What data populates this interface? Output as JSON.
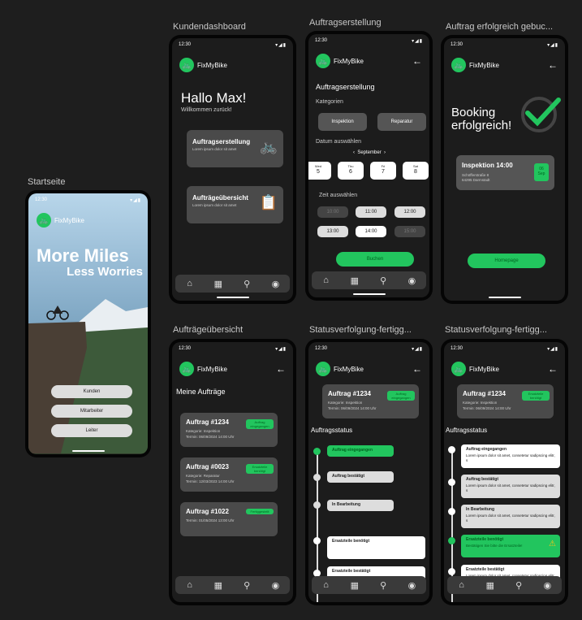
{
  "frames": {
    "startseite": "Startseite",
    "kundendashboard": "Kundendashboard",
    "auftragserstellung": "Auftragserstellung",
    "erfolg": "Auftrag erfolgreich gebuc...",
    "uebersicht": "Aufträgeübersicht",
    "status1": "Statusverfolgung-fertigg...",
    "status2": "Statusverfolgung-fertigg..."
  },
  "status_time": "12:30",
  "status_icons": "▾◢▮",
  "brand": "FixMyBike",
  "nav_icons": [
    "⌂",
    "▦",
    "⚲",
    "◉"
  ],
  "start": {
    "headline1": "More Miles",
    "headline2": "Less Worries",
    "buttons": [
      "Kunden",
      "Mitarbeiter",
      "Leiter"
    ]
  },
  "dashboard": {
    "greeting": "Hallo Max!",
    "welcome": "Willkommen zurück!",
    "card1_title": "Auftragserstellung",
    "card1_sub": "Lorem ipsum dolor sit amet",
    "card2_title": "Aufträgeübersicht",
    "card2_sub": "Lorem ipsum dolor sit amet"
  },
  "create": {
    "title": "Auftragserstellung",
    "categories_label": "Kategorien",
    "cat1": "Inspektion",
    "cat2": "Reparatur",
    "date_label": "Datum auswählen",
    "month": "September",
    "days": [
      {
        "wd": "Wed",
        "d": "5"
      },
      {
        "wd": "Thu",
        "d": "6"
      },
      {
        "wd": "Fri",
        "d": "7"
      },
      {
        "wd": "Sat",
        "d": "8"
      }
    ],
    "time_label": "Zeit auswählen",
    "times": [
      "10:00",
      "11:00",
      "12:00",
      "13:00",
      "14:00",
      "15:00"
    ],
    "book": "Buchen"
  },
  "success": {
    "line1": "Booking",
    "line2": "erfolgreich!",
    "card_title": "Inspektion 14:00",
    "card_addr1": "Schöfferstraße 8",
    "card_addr2": "64295 Darmstadt",
    "badge_day": "06",
    "badge_month": "Sep",
    "homepage": "Homepage"
  },
  "overview": {
    "title": "Meine Aufträge",
    "orders": [
      {
        "title": "Auftrag #1234",
        "l1": "Kategorie: Inspektion",
        "l2": "Termin: 06/09/2024 14:00 Uhr",
        "badge": "Auftrag eingegangen"
      },
      {
        "title": "Auftrag #0023",
        "l1": "Kategorie: Reparatur",
        "l2": "Termin: 12/03/2023 14:00 Uhr",
        "badge": "Ersatzteile benötigt"
      },
      {
        "title": "Auftrag #1022",
        "l1": "Termin: 01/05/2024 13:00 Uhr",
        "l2": "",
        "badge": "Fertiggestellt"
      }
    ]
  },
  "status1": {
    "card_title": "Auftrag #1234",
    "card_l1": "Kategorie: Inspektion",
    "card_l2": "Termin: 06/09/2024 14:00 Uhr",
    "badge": "Auftrag eingegangen",
    "section": "Auftragsstatus",
    "steps": [
      "Auftrag eingegangen",
      "Auftrag bestätigt",
      "In Bearbeitung",
      "Ersatzteile benötigt",
      "Ersatzteile bestätigt",
      "Fertiggestellt"
    ]
  },
  "status2": {
    "card_title": "Auftrag #1234",
    "card_l1": "Kategorie: Inspektion",
    "card_l2": "Termin: 06/09/2024 14:00 Uhr",
    "badge": "Ersatzteile benötigt",
    "section": "Auftragsstatus",
    "lorem": "Lorem ipsum dolor sit amet, consetetur sadipscing elitr, s",
    "steps": [
      "Auftrag eingegangen",
      "Auftrag bestätigt",
      "In Bearbeitung",
      "Ersatzteile benötigt",
      "Ersatzteile bestätigt",
      "Fertiggestellt"
    ],
    "confirm_text": "Bestätigen Sie bitte die Ersatzteile!"
  },
  "colors": {
    "accent": "#22c55e",
    "card": "#4a4a4a",
    "bg": "#1e1e1e"
  }
}
